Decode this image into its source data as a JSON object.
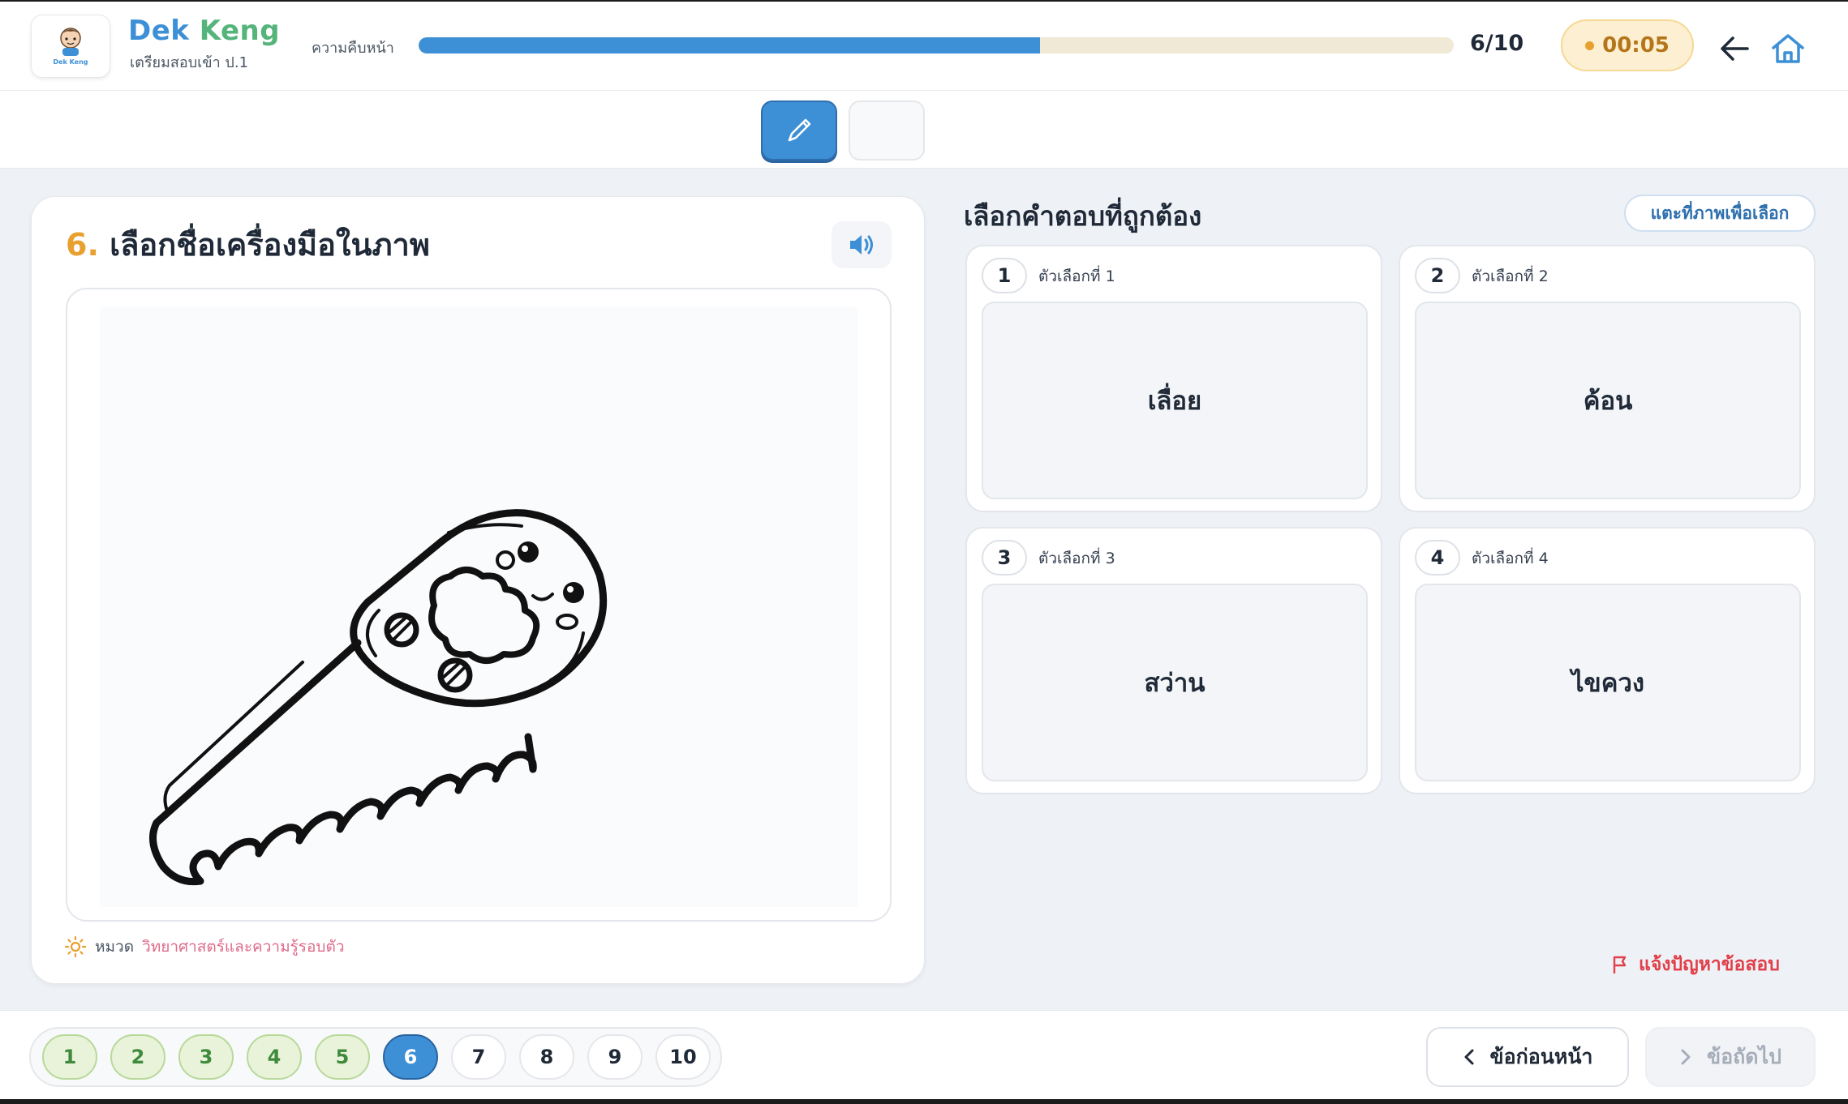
{
  "header": {
    "brand_part1": "Dek ",
    "brand_part2": "Keng",
    "subtitle": "เตรียมสอบเข้า ป.1",
    "logo_text": "Dek Keng",
    "progress_label": "ความคืบหน้า",
    "progress_fraction": 0.6,
    "progress_count": "6/10",
    "timer": "00:05"
  },
  "question": {
    "number": "6.",
    "text": "เลือกชื่อเครื่องมือในภาพ",
    "category_label": "หมวด",
    "category_value": "วิทยาศาสตร์และความรู้รอบตัว"
  },
  "answers": {
    "title": "เลือกคำตอบที่ถูกต้อง",
    "tap_hint": "แตะที่ภาพเพื่อเลือก",
    "options": [
      {
        "num": "1",
        "label": "ตัวเลือกที่ 1",
        "text": "เลื่อย"
      },
      {
        "num": "2",
        "label": "ตัวเลือกที่ 2",
        "text": "ค้อน"
      },
      {
        "num": "3",
        "label": "ตัวเลือกที่ 3",
        "text": "สว่าน"
      },
      {
        "num": "4",
        "label": "ตัวเลือกที่ 4",
        "text": "ไขควง"
      }
    ],
    "report": "แจ้งปัญหาข้อสอบ"
  },
  "pager": {
    "pages": [
      "1",
      "2",
      "3",
      "4",
      "5",
      "6",
      "7",
      "8",
      "9",
      "10"
    ],
    "current": 6
  },
  "nav": {
    "prev": "ข้อก่อนหน้า",
    "next": "ข้อถัดไป"
  },
  "colors": {
    "accent": "#3d8fd6",
    "brand_green": "#54b47a",
    "timer_bg": "#fdf0d2",
    "report_red": "#e0404a",
    "done_green": "#e8f3da"
  }
}
